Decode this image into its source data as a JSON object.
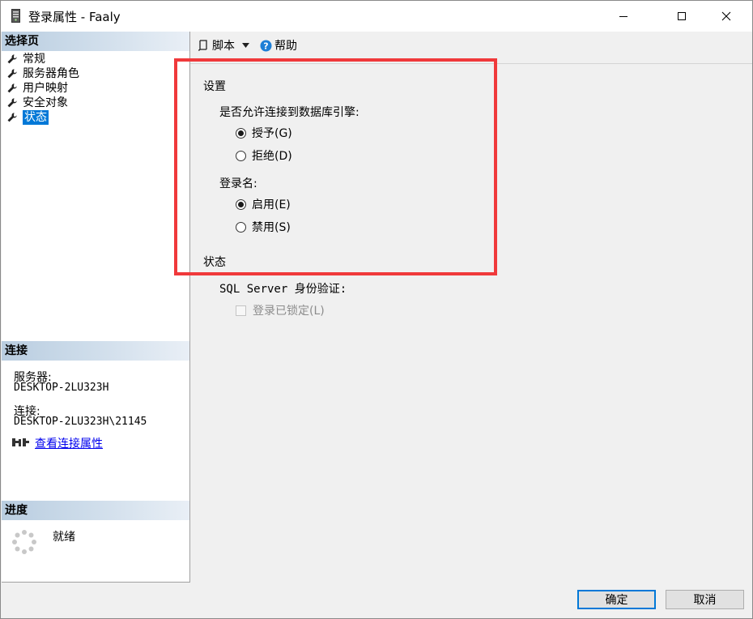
{
  "window": {
    "title": "登录属性 - Faaly"
  },
  "left_pane": {
    "select_page_header": "选择页",
    "pages": [
      {
        "label": "常规",
        "selected": false
      },
      {
        "label": "服务器角色",
        "selected": false
      },
      {
        "label": "用户映射",
        "selected": false
      },
      {
        "label": "安全对象",
        "selected": false
      },
      {
        "label": "状态",
        "selected": true
      }
    ],
    "connection_header": "连接",
    "server_label": "服务器:",
    "server_value": "DESKTOP-2LU323H",
    "connection_label": "连接:",
    "connection_value": "DESKTOP-2LU323H\\21145",
    "view_connection_link": "查看连接属性",
    "progress_header": "进度",
    "progress_status": "就绪"
  },
  "toolbar": {
    "script_label": "脚本",
    "help_label": "帮助"
  },
  "settings": {
    "group_title": "设置",
    "db_engine_question": "是否允许连接到数据库引擎:",
    "grant_label": "授予(G)",
    "grant_checked": true,
    "deny_label": "拒绝(D)",
    "deny_checked": false,
    "login_label": "登录名:",
    "enable_label": "启用(E)",
    "enable_checked": true,
    "disable_label": "禁用(S)",
    "disable_checked": false
  },
  "status": {
    "group_title": "状态",
    "sql_auth_label": "SQL Server 身份验证:",
    "locked_label": "登录已锁定(L)",
    "locked_checked": false
  },
  "buttons": {
    "ok": "确定",
    "cancel": "取消"
  },
  "colors": {
    "highlight": "#f0393b",
    "selection": "#0078d7",
    "link": "#0000ee"
  }
}
